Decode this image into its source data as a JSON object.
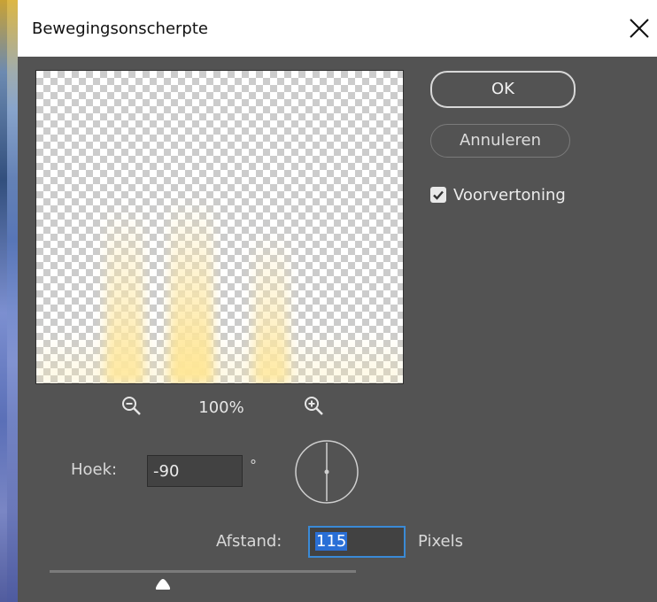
{
  "dialog": {
    "title": "Bewegingsonscherpte",
    "close_icon": "close-icon"
  },
  "preview": {
    "zoom_label": "100%",
    "zoom_out_icon": "zoom-out-icon",
    "zoom_in_icon": "zoom-in-icon"
  },
  "buttons": {
    "ok_label": "OK",
    "cancel_label": "Annuleren"
  },
  "preview_option": {
    "label": "Voorvertoning",
    "checked": true
  },
  "angle": {
    "label": "Hoek:",
    "value": "-90",
    "unit": "°",
    "dial_icon": "angle-dial-icon"
  },
  "distance": {
    "label": "Afstand:",
    "value": "115",
    "unit": "Pixels",
    "slider_fraction": 0.44
  },
  "colors": {
    "panel_bg": "#535353",
    "accent": "#2a6fd6",
    "streak": "#ffe9a6"
  }
}
